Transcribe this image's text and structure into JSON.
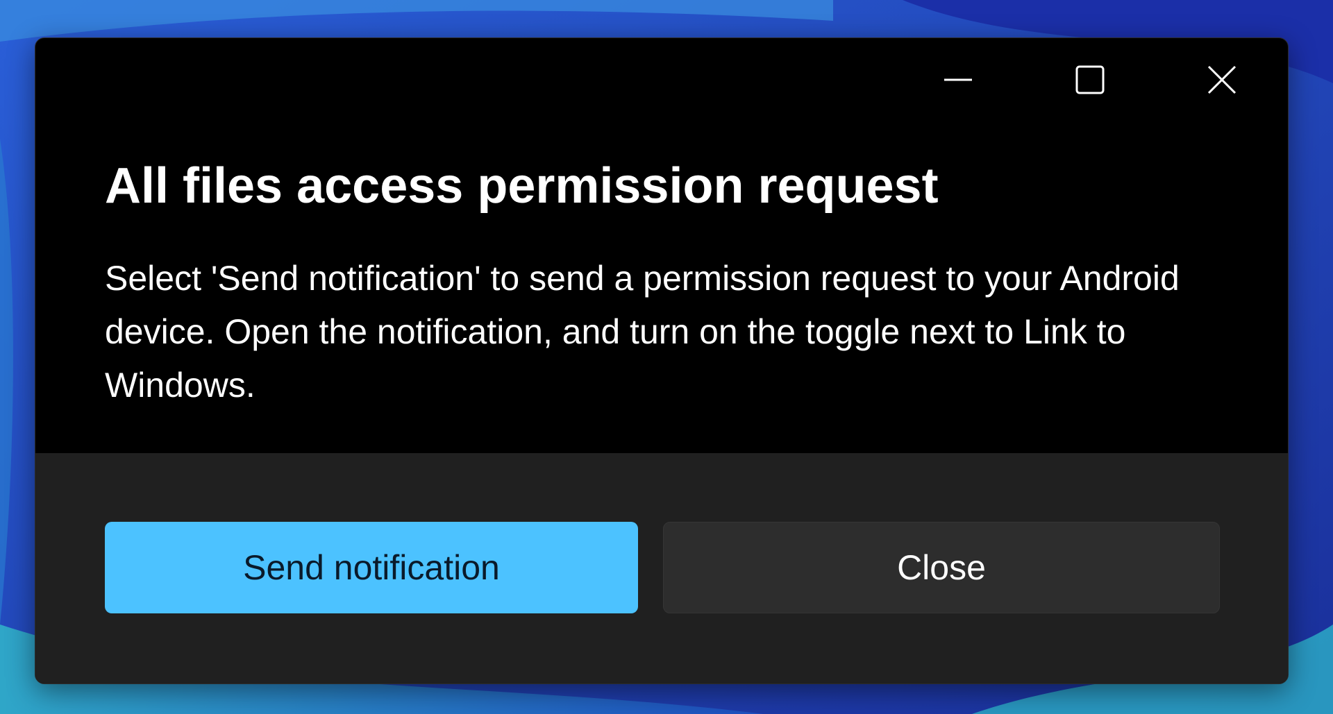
{
  "dialog": {
    "title": "All files access permission request",
    "body": "Select 'Send notification' to send a permission request to your Android device. Open the notification, and turn on the toggle next to Link to Windows."
  },
  "caption_buttons": {
    "minimize_icon": "minimize-icon",
    "maximize_icon": "maximize-icon",
    "close_icon": "close-icon"
  },
  "buttons": {
    "primary_label": "Send notification",
    "secondary_label": "Close"
  },
  "colors": {
    "accent": "#4cc2ff",
    "dialog_background": "#000000",
    "footer_background": "#202020",
    "secondary_button": "#2d2d2d"
  }
}
